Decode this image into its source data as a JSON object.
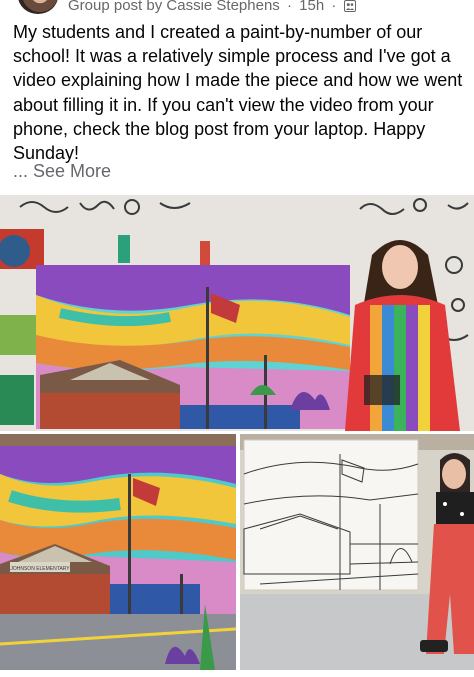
{
  "post": {
    "meta_prefix": "Group post by",
    "author": "Cassie Stephens",
    "separator": "·",
    "time": "15h",
    "separator2": "·",
    "privacy_icon": "group-icon",
    "text": "My students and I created a paint-by-number of our school! It was a relatively simple process and I've got a video explaining how I made the piece and how we went about filling it in. If you can't view the video from your phone, check the blog post from your laptop. Happy Sunday!",
    "see_more": "... See More"
  },
  "photos": {
    "count": 3,
    "bottom_left_sign": "JOHNSON ELEMENTARY"
  },
  "colors": {
    "meta_text": "#65676b",
    "body_text": "#050505",
    "see_more": "#65676b"
  }
}
